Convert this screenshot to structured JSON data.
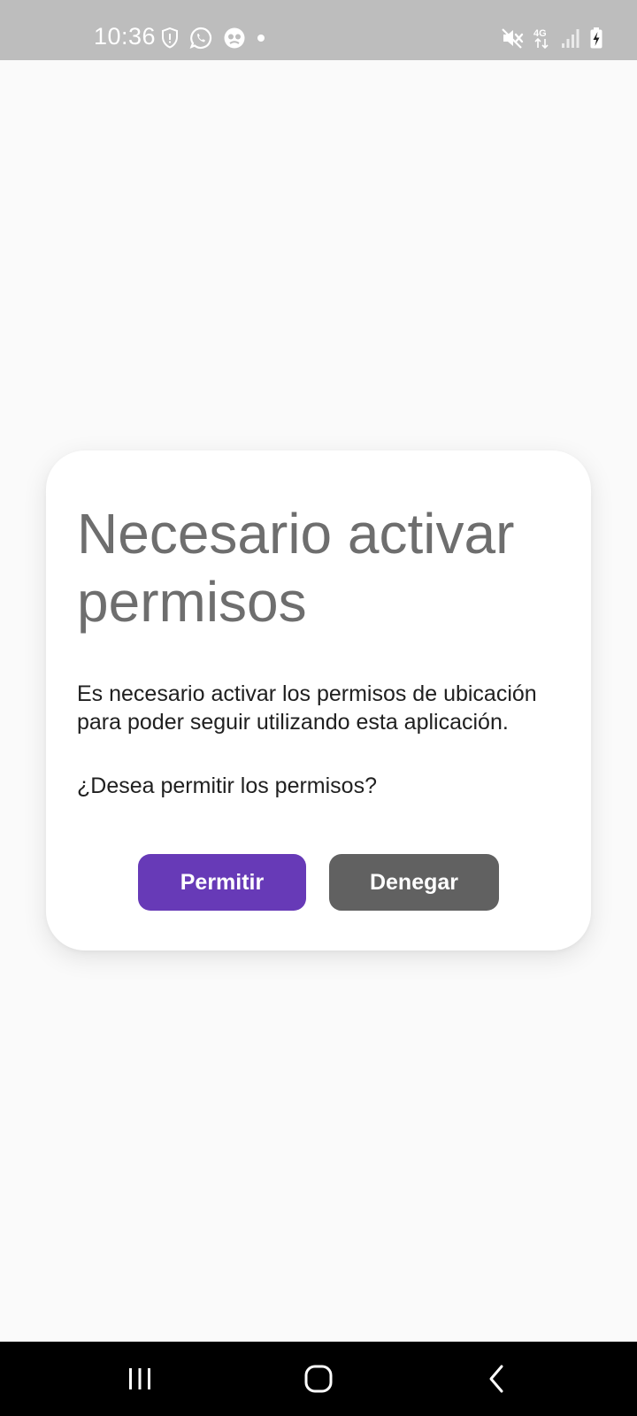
{
  "status_bar": {
    "time": "10:36",
    "left_icons": [
      "shield-alert-icon",
      "whatsapp-icon",
      "app-notification-icon",
      "dot-icon"
    ],
    "right_icons": [
      "vibrate-mute-icon",
      "network-4g-icon",
      "signal-icon",
      "battery-charging-icon"
    ],
    "network_label": "4G"
  },
  "dialog": {
    "title": "Necesario activar permisos",
    "message": "Es necesario activar los permisos de ubicación para poder seguir utilizando esta aplicación.",
    "question": "¿Desea permitir los permisos?",
    "allow_label": "Permitir",
    "deny_label": "Denegar"
  },
  "nav_bar": {
    "buttons": [
      "recents-icon",
      "home-icon",
      "back-icon"
    ]
  },
  "colors": {
    "accent": "#673ab7",
    "secondary_button": "#616161",
    "status_bar": "#bdbdbd",
    "title_text": "#6e6e6e",
    "background": "#fafafa"
  }
}
